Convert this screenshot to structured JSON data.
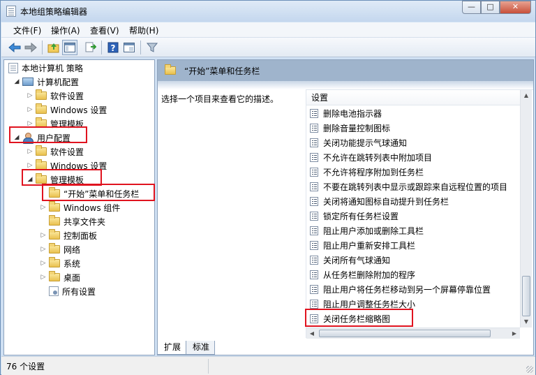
{
  "window": {
    "title": "本地组策略编辑器",
    "buttons": {
      "minimize": "—",
      "maximize": "□",
      "close": "✕"
    }
  },
  "menubar": [
    "文件(F)",
    "操作(A)",
    "查看(V)",
    "帮助(H)"
  ],
  "toolbar": {
    "icons": [
      "back-arrow-icon",
      "forward-arrow-icon",
      "up-folder-icon",
      "show-hide-tree-icon",
      "export-list-icon",
      "help-icon",
      "console-tree-icon",
      "filter-icon"
    ]
  },
  "tree": {
    "root": "本地计算机 策略",
    "computer_config": "计算机配置",
    "cc_software": "软件设置",
    "cc_windows": "Windows 设置",
    "cc_admin": "管理模板",
    "user_config": "用户配置",
    "uc_software": "软件设置",
    "uc_windows": "Windows 设置",
    "uc_admin": "管理模板",
    "start_menu": "“开始”菜单和任务栏",
    "windows_components": "Windows 组件",
    "shared_folders": "共享文件夹",
    "control_panel": "控制面板",
    "network": "网络",
    "system": "系统",
    "desktop": "桌面",
    "all_settings": "所有设置"
  },
  "right_pane": {
    "header_title": "“开始”菜单和任务栏",
    "description": "选择一个项目来查看它的描述。",
    "list_header": "设置",
    "items": [
      "删除电池指示器",
      "删除音量控制图标",
      "关闭功能提示气球通知",
      "不允许在跳转列表中附加项目",
      "不允许将程序附加到任务栏",
      "不要在跳转列表中显示或跟踪来自远程位置的项目",
      "关闭将通知图标自动提升到任务栏",
      "锁定所有任务栏设置",
      "阻止用户添加或删除工具栏",
      "阻止用户重新安排工具栏",
      "关闭所有气球通知",
      "从任务栏删除附加的程序",
      "阻止用户将任务栏移动到另一个屏幕停靠位置",
      "阻止用户调整任务栏大小",
      "关闭任务栏缩略图"
    ]
  },
  "tabs": {
    "extended": "扩展",
    "standard": "标准"
  },
  "status": {
    "text": "76 个设置"
  },
  "colors": {
    "highlight": "#e0131f",
    "header_band": "#9fb4cc",
    "window_frame": "#cfe0f3"
  }
}
